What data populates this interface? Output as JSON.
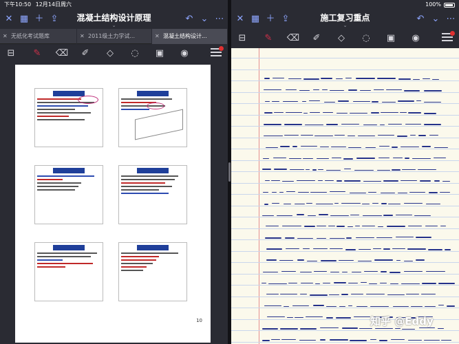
{
  "status": {
    "time": "下午10:50",
    "date": "12月14日周六",
    "battery": "100%"
  },
  "left": {
    "title": "混凝土结构设计原理",
    "subtitle": "",
    "tabs": [
      {
        "label": "无纸化考试题库"
      },
      {
        "label": "2011级土力学试..."
      },
      {
        "label": "混凝土结构设计..."
      }
    ],
    "page_number": "10"
  },
  "right": {
    "title": "施工复习重点"
  },
  "watermark": "知乎 @Eddy",
  "colors": {
    "accent": "#8ea6ff",
    "pen": "#d0304a",
    "ink": "#24318a",
    "slide_title": "#1f3f9a"
  },
  "icons": [
    "close-icon",
    "grid-icon",
    "plus-icon",
    "share-icon",
    "undo-icon",
    "chevron-down-icon",
    "ellipsis-icon",
    "pen-icon",
    "eraser-icon",
    "highlighter-icon",
    "shapes-icon",
    "lasso-icon",
    "image-icon",
    "camera-icon",
    "menu-icon"
  ]
}
